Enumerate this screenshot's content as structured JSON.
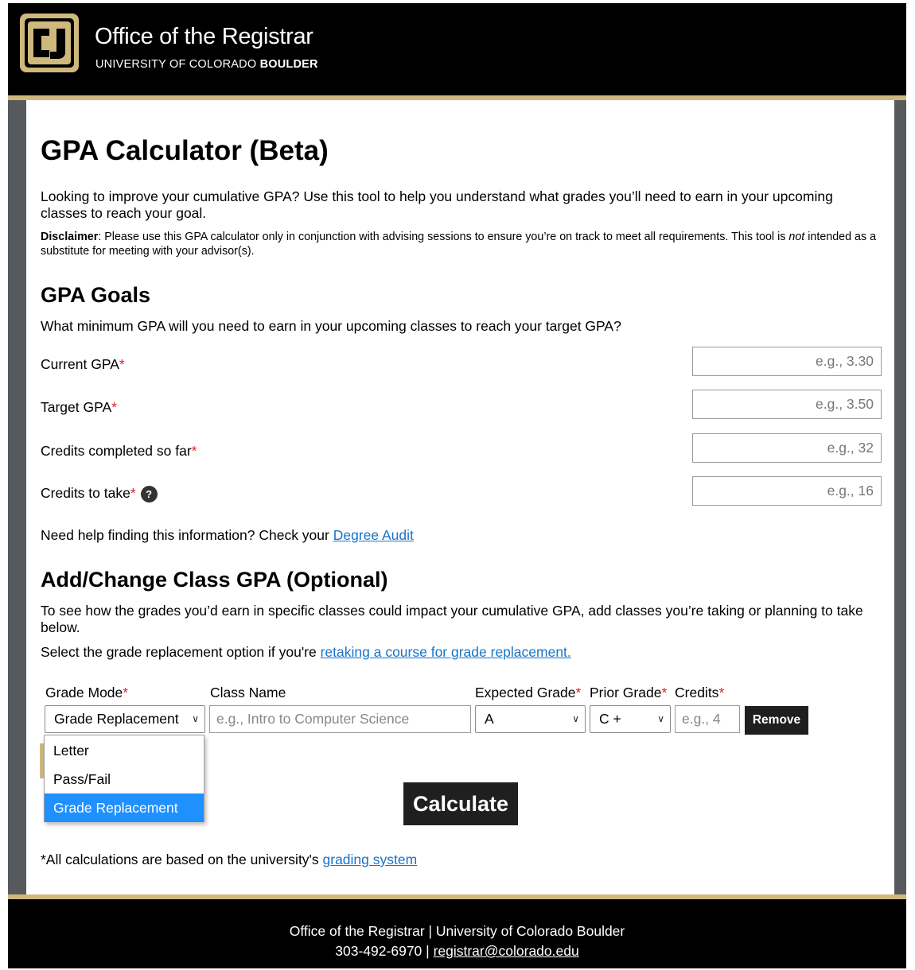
{
  "header": {
    "title": "Office of the Registrar",
    "subtitle_normal": "UNIVERSITY OF COLORADO ",
    "subtitle_bold": "BOULDER",
    "logo_text": "CU"
  },
  "page": {
    "title": "GPA Calculator (Beta)",
    "intro": "Looking to improve your cumulative GPA? Use this tool to help you understand what grades you’ll need to earn in your upcoming classes to reach your goal.",
    "disclaimer_label": "Disclaimer",
    "disclaimer_text_1": ": Please use this GPA calculator only in conjunction with advising sessions to ensure you’re on track to meet all requirements. This tool is ",
    "disclaimer_italic": "not",
    "disclaimer_text_2": " intended as a substitute for meeting with your advisor(s)."
  },
  "gpa_goals": {
    "heading": "GPA Goals",
    "question": "What minimum GPA will you need to earn in your upcoming classes to reach your target GPA?",
    "fields": [
      {
        "label": "Current GPA",
        "required": "*",
        "placeholder": "e.g., 3.30",
        "value": ""
      },
      {
        "label": "Target GPA",
        "required": "*",
        "placeholder": "e.g., 3.50",
        "value": ""
      },
      {
        "label": "Credits completed so far",
        "required": "*",
        "placeholder": "e.g., 32",
        "value": ""
      },
      {
        "label": "Credits to take",
        "required": "*",
        "placeholder": "e.g., 16",
        "value": "",
        "help": "?"
      }
    ],
    "help_text": "Need help finding this information? Check your ",
    "help_link": "Degree Audit"
  },
  "class_section": {
    "heading": "Add/Change Class GPA (Optional)",
    "intro": "To see how the grades you’d earn in specific classes could impact your cumulative GPA, add classes you’re taking or planning to take below.",
    "replacement_text": "Select the grade replacement option if you're ",
    "replacement_link": "retaking a course for grade replacement.",
    "columns": {
      "grade_mode": "Grade Mode",
      "class_name": "Class Name",
      "expected_grade": "Expected Grade",
      "prior_grade": "Prior Grade",
      "credits": "Credits",
      "required": "*"
    },
    "row": {
      "grade_mode": "Grade Replacement",
      "class_name_placeholder": "e.g., Intro to Computer Science",
      "class_name": "",
      "expected_grade": "A",
      "prior_grade": "C +",
      "credits_placeholder": "e.g., 4",
      "credits": "",
      "remove_label": "Remove"
    },
    "grade_mode_options": [
      "Letter",
      "Pass/Fail",
      "Grade Replacement"
    ],
    "selected_option": "Grade Replacement",
    "calculate_label": "Calculate",
    "note_text": "*All calculations are based on the university's ",
    "note_link": "grading system"
  },
  "footer": {
    "line1": "Office of the Registrar | University of Colorado Boulder",
    "phone": "303-492-6970",
    "separator": " | ",
    "email": "registrar@colorado.edu"
  },
  "colors": {
    "gold": "#cfb87c",
    "black": "#000000",
    "frame_gray": "#565a5c",
    "link": "#1a73c6",
    "required": "#e0202a",
    "selected_option": "#1e90ff"
  }
}
